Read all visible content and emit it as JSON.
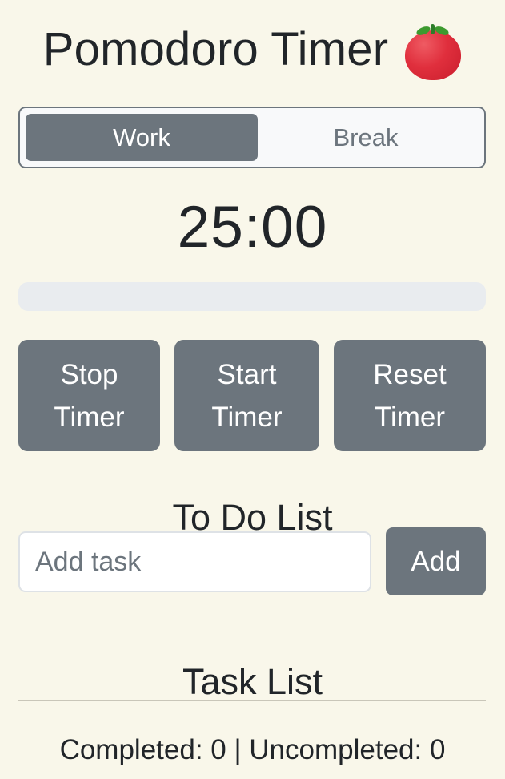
{
  "header": {
    "title": "Pomodoro Timer",
    "icon": "tomato-icon"
  },
  "mode": {
    "work_label": "Work",
    "break_label": "Break",
    "active": "Work"
  },
  "timer": {
    "display": "25:00",
    "progress_percent": 0
  },
  "controls": {
    "stop_label": "Stop\nTimer",
    "start_label": "Start\nTimer",
    "reset_label": "Reset\nTimer"
  },
  "todo": {
    "heading": "To Do List",
    "input_placeholder": "Add task",
    "input_value": "",
    "add_label": "Add",
    "task_list_heading": "Task List",
    "tasks": []
  },
  "stats": {
    "text": "Completed: 0 | Uncompleted: 0"
  },
  "colors": {
    "background": "#f9f7ea",
    "button": "#6c757d",
    "text": "#212529",
    "progress_track": "#e9ecef"
  }
}
